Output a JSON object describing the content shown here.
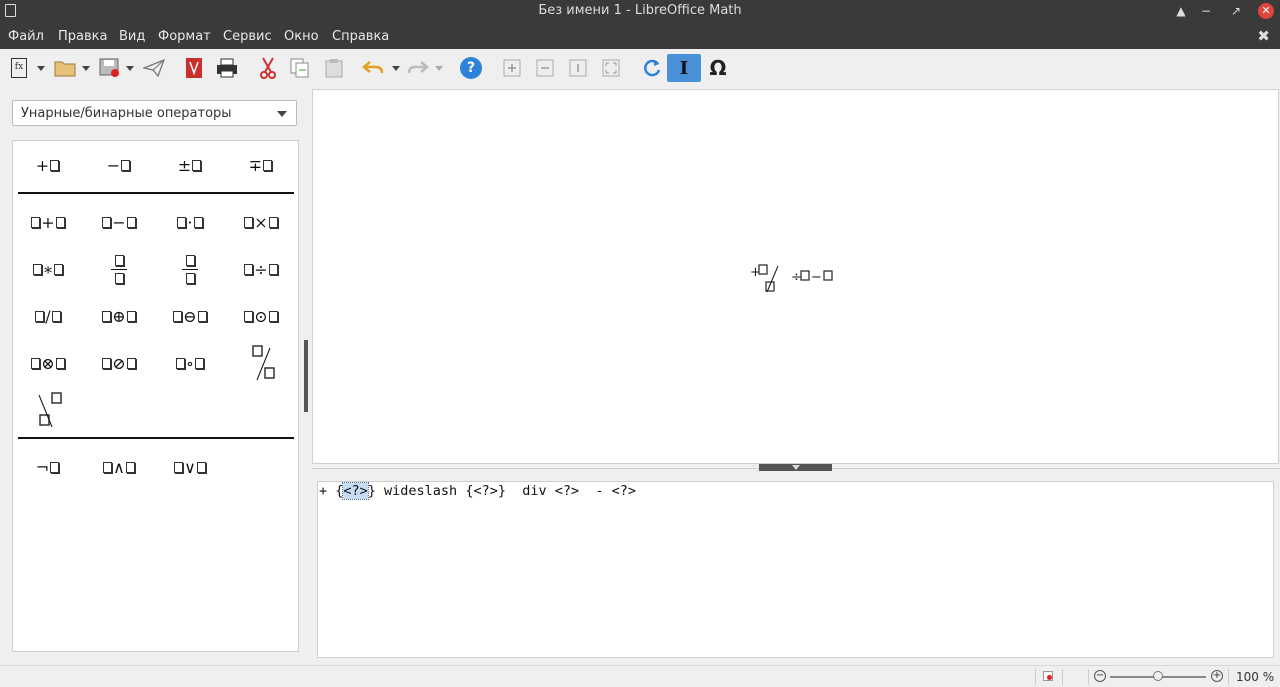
{
  "window": {
    "title": "Без имени 1 - LibreOffice Math",
    "buttons": {
      "minimize_up": "▲",
      "minimize": "−",
      "restore": "↗",
      "close": "✕"
    }
  },
  "menu": {
    "items": [
      "Файл",
      "Правка",
      "Вид",
      "Формат",
      "Сервис",
      "Окно",
      "Справка"
    ],
    "close_doc": "✖"
  },
  "toolbar": {
    "buttons": [
      "new-formula",
      "open",
      "save",
      "send",
      "export-pdf",
      "print",
      "cut",
      "copy",
      "paste",
      "undo",
      "redo",
      "help",
      "zoom-in",
      "zoom-out",
      "zoom-100",
      "show-all",
      "update",
      "formula-cursor",
      "symbols"
    ],
    "new_icon_text": "fx",
    "help_text": "?",
    "symbols_text": "Ω",
    "cursor_text": "I"
  },
  "elements_panel": {
    "category": "Унарные/бинарные операторы"
  },
  "view": {
    "formula_text": "+□ ∕ □÷□−□"
  },
  "editor": {
    "before": "+ {",
    "selected": "<?>",
    "after": "} wideslash {<?>}  div <?>  - <?>"
  },
  "statusbar": {
    "zoom_minus": "−",
    "zoom_plus": "+",
    "zoom": "100 %",
    "zoom_level_percent": 100
  }
}
